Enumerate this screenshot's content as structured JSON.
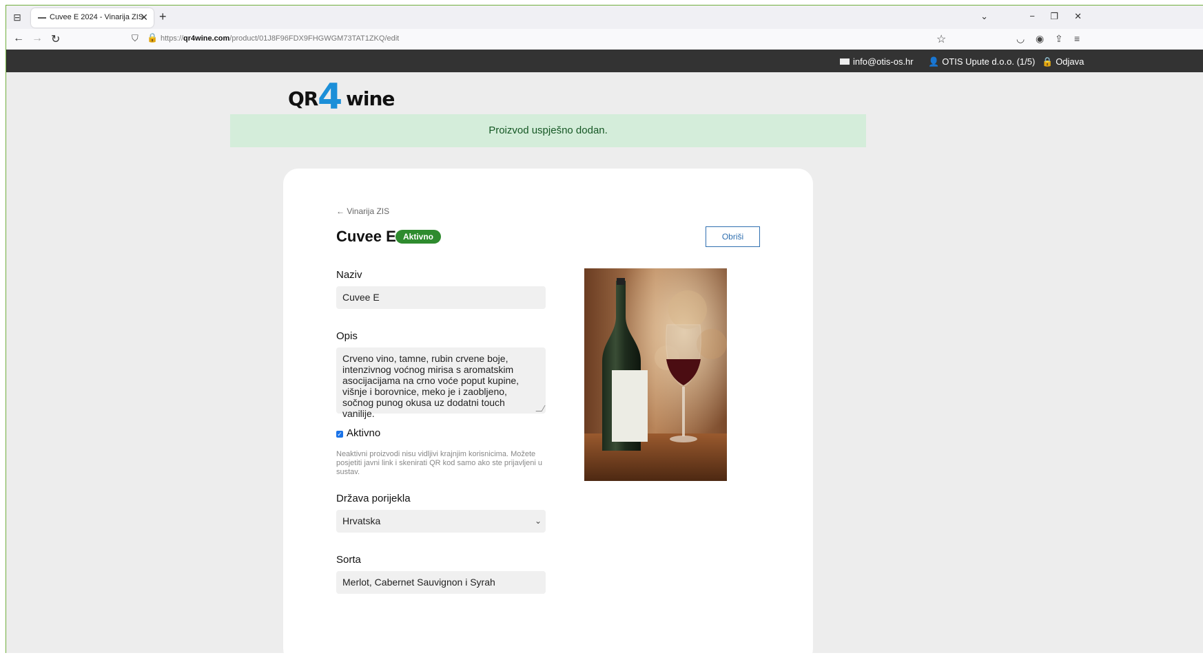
{
  "browser": {
    "tab_title": "Cuvee E 2024 - Vinarija ZIS",
    "url_prefix": "https://",
    "url_domain": "qr4wine.com",
    "url_path": "/product/01J8F96FDX9FHGWGM73TAT1ZKQ/edit"
  },
  "topbar": {
    "email": "info@otis-os.hr",
    "company": "OTIS Upute d.o.o. (1/5)",
    "logout": "Odjava"
  },
  "logo": {
    "part1": "QR",
    "part2": "4",
    "part3": "wine"
  },
  "alert": {
    "message": "Proizvod uspješno dodan."
  },
  "product": {
    "back_link": "← Vinarija ZIS",
    "title": "Cuvee E",
    "status_badge": "Aktivno",
    "delete_button": "Obriši"
  },
  "form": {
    "name_label": "Naziv",
    "name_value": "Cuvee E",
    "description_label": "Opis",
    "description_value": "Crveno vino, tamne, rubin crvene boje, intenzivnog voćnog mirisa s aromatskim asocijacijama na crno voće poput kupine, višnje i borovnice, meko je i zaobljeno, sočnog punog okusa uz dodatni touch vanilije.",
    "active_label": "Aktivno",
    "active_checked": true,
    "active_help": "Neaktivni proizvodi nisu vidljivi krajnjim korisnicima. Možete posjetiti javni link i skenirati QR kod samo ako ste prijavljeni u sustav.",
    "country_label": "Država porijekla",
    "country_value": "Hrvatska",
    "variety_label": "Sorta",
    "variety_value": "Merlot, Cabernet Sauvignon i Syrah"
  },
  "colors": {
    "accent": "#1c8fd8",
    "success_bg": "#d4edda",
    "badge_green": "#2e8b2e",
    "topbar_bg": "#333333"
  }
}
